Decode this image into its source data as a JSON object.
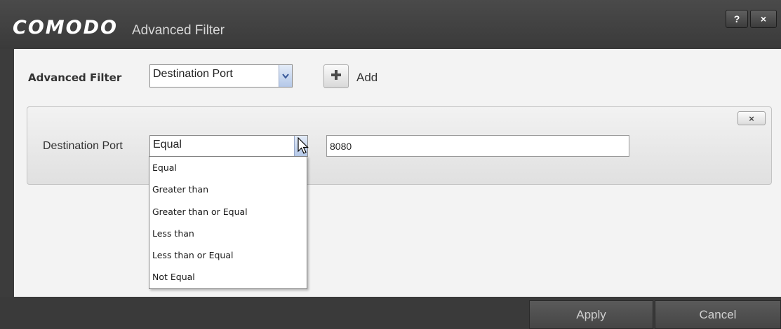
{
  "window": {
    "logo": "COMODO",
    "title": "Advanced Filter",
    "help_label": "?",
    "close_label": "×"
  },
  "filter_bar": {
    "label": "Advanced Filter",
    "type_select_value": "Destination Port",
    "add_label": "Add"
  },
  "rule": {
    "label": "Destination Port",
    "operator_value": "Equal",
    "value": "8080",
    "remove_label": "×"
  },
  "operator_options": [
    "Equal",
    "Greater than",
    "Greater than or Equal",
    "Less than",
    "Less than or Equal",
    "Not Equal"
  ],
  "footer": {
    "apply_label": "Apply",
    "cancel_label": "Cancel"
  },
  "icons": {
    "add": "plus-icon",
    "dropdown": "chevron-down-icon",
    "cursor": "mouse-pointer-icon"
  },
  "colors": {
    "titlebar": "#3c3c3c",
    "content_bg": "#f3f3f3",
    "add_plus": "#4a4a4a",
    "select_arrow": "#3a5a9a"
  }
}
